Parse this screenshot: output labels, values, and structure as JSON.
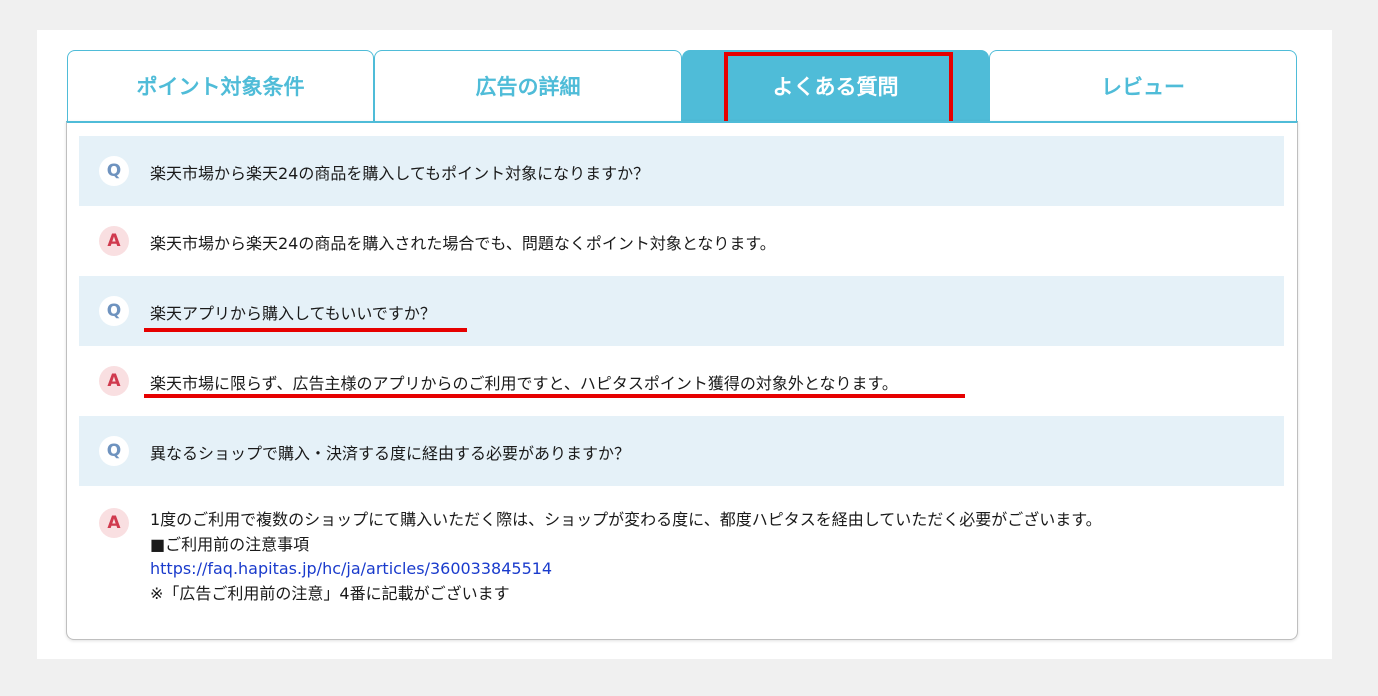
{
  "tabs": [
    {
      "label": "ポイント対象条件",
      "active": false
    },
    {
      "label": "広告の詳細",
      "active": false
    },
    {
      "label": "よくある質問",
      "active": true
    },
    {
      "label": "レビュー",
      "active": false
    }
  ],
  "badges": {
    "q": "Q",
    "a": "A"
  },
  "faq": [
    {
      "q": "楽天市場から楽天24の商品を購入してもポイント対象になりますか？",
      "a": "楽天市場から楽天24の商品を購入された場合でも、問題なくポイント対象となります。"
    },
    {
      "q": "楽天アプリから購入してもいいですか？",
      "a": "楽天市場に限らず、広告主様のアプリからのご利用ですと、ハピタスポイント獲得の対象外となります。"
    },
    {
      "q": "異なるショップで購入・決済する度に経由する必要がありますか？",
      "a_lines": [
        "1度のご利用で複数のショップにて購入いただく際は、ショップが変わる度に、都度ハピタスを経由していただく必要がございます。",
        "■ご利用前の注意事項",
        "https://faq.hapitas.jp/hc/ja/articles/360033845514",
        "※「広告ご利用前の注意」4番に記載がございます"
      ]
    }
  ],
  "colors": {
    "accent": "#4fbcd8",
    "highlight": "#e60000",
    "q_bg": "#e5f1f8",
    "link": "#1a3bcc"
  }
}
